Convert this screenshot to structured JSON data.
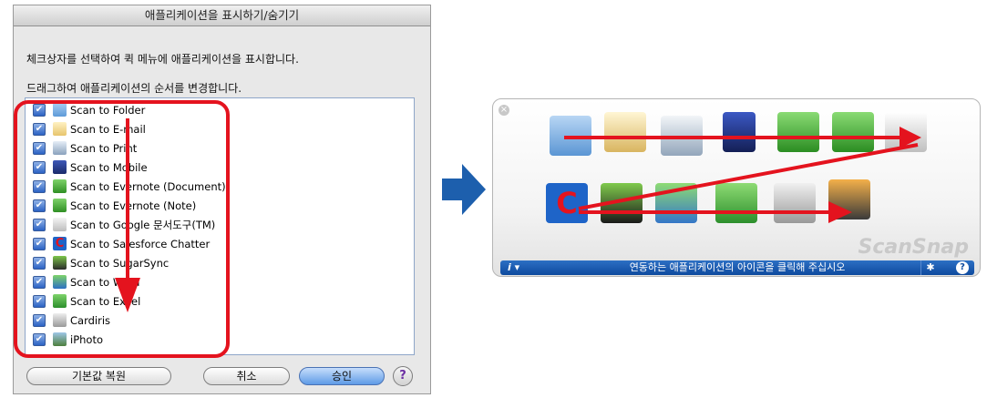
{
  "dialog": {
    "title": "애플리케이션을 표시하기/숨기기",
    "description_line1": "체크상자를 선택하여 퀵 메뉴에 애플리케이션을 표시합니다.",
    "description_line2": "드래그하여 애플리케이션의 순서를 변경합니다.",
    "apps": [
      {
        "label": "Scan to Folder",
        "checked": true,
        "icon": "folder-icon"
      },
      {
        "label": "Scan to E-mail",
        "checked": true,
        "icon": "email-icon"
      },
      {
        "label": "Scan to Print",
        "checked": true,
        "icon": "printer-icon"
      },
      {
        "label": "Scan to Mobile",
        "checked": true,
        "icon": "mobile-icon"
      },
      {
        "label": "Scan to Evernote (Document)",
        "checked": true,
        "icon": "evernote-document-icon"
      },
      {
        "label": "Scan to Evernote (Note)",
        "checked": true,
        "icon": "evernote-note-icon"
      },
      {
        "label": "Scan to Google 문서도구(TM)",
        "checked": true,
        "icon": "google-docs-icon"
      },
      {
        "label": "Scan to Salesforce Chatter",
        "checked": true,
        "icon": "salesforce-chatter-icon"
      },
      {
        "label": "Scan to SugarSync",
        "checked": true,
        "icon": "sugarsync-icon"
      },
      {
        "label": "Scan to Word",
        "checked": true,
        "icon": "word-icon"
      },
      {
        "label": "Scan to Excel",
        "checked": true,
        "icon": "excel-icon"
      },
      {
        "label": "Cardiris",
        "checked": true,
        "icon": "cardiris-icon"
      },
      {
        "label": "iPhoto",
        "checked": true,
        "icon": "iphoto-icon"
      }
    ],
    "buttons": {
      "restore_default": "기본값 복원",
      "cancel": "취소",
      "ok": "승인",
      "help": "?"
    }
  },
  "quick_menu": {
    "status_text": "연동하는 애플리케이션의 아이콘을 클릭해 주십시오",
    "info_label": "i ▾",
    "gear_glyph": "✱",
    "help_glyph": "?",
    "brand": "ScanSnap",
    "close_glyph": "×"
  },
  "colors": {
    "annotation_red": "#e4131e",
    "arrow_blue": "#1d5fad",
    "bar_blue": "#1a5cb0"
  }
}
